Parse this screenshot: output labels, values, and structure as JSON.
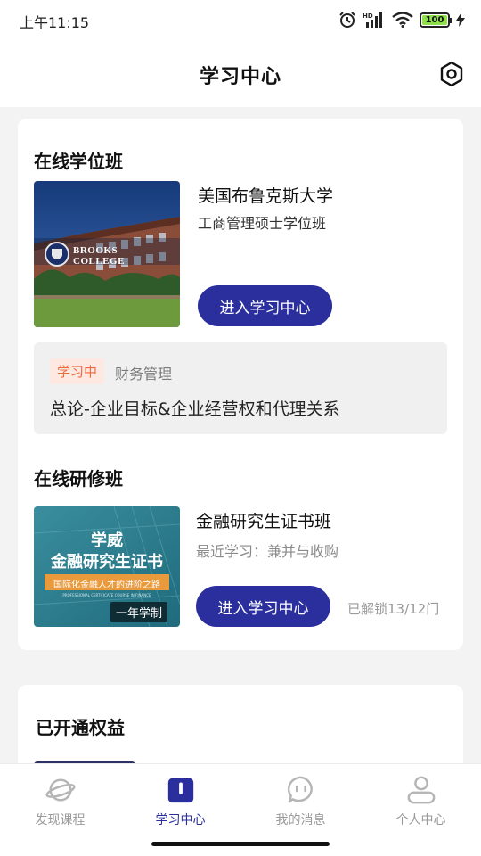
{
  "status": {
    "time": "上午11:15",
    "battery": "100",
    "battery_level": 1.0
  },
  "header": {
    "title": "学习中心"
  },
  "degree": {
    "section_title": "在线学位班",
    "thumb_text_line1": "BROOKS",
    "thumb_text_line2": "COLLEGE",
    "university": "美国布鲁克斯大学",
    "program": "工商管理硕士学位班",
    "enter_label": "进入学习中心",
    "progress": {
      "tag": "学习中",
      "subject": "财务管理",
      "lesson": "总论-企业目标&企业经营权和代理关系"
    }
  },
  "training": {
    "section_title": "在线研修班",
    "thumb_line1": "学威",
    "thumb_line2": "金融研究生证书",
    "thumb_banner": "国际化金融人才的进阶之路",
    "thumb_banner_sub": "PROFESSIONAL CERTIFICATE COURSE IN FINANCE",
    "thumb_badge": "一年学制",
    "name": "金融研究生证书班",
    "recent": "最近学习：兼并与收购",
    "enter_label": "进入学习中心",
    "unlocked": "已解锁13/12门"
  },
  "benefits": {
    "section_title": "已开通权益"
  },
  "tabs": [
    {
      "label": "发现课程",
      "icon": "planet-icon"
    },
    {
      "label": "学习中心",
      "icon": "book-icon"
    },
    {
      "label": "我的消息",
      "icon": "message-icon"
    },
    {
      "label": "个人中心",
      "icon": "user-icon"
    }
  ],
  "colors": {
    "primary": "#2a2f9d",
    "tag_bg": "#fde8e2",
    "tag_text": "#ee6a3f"
  }
}
